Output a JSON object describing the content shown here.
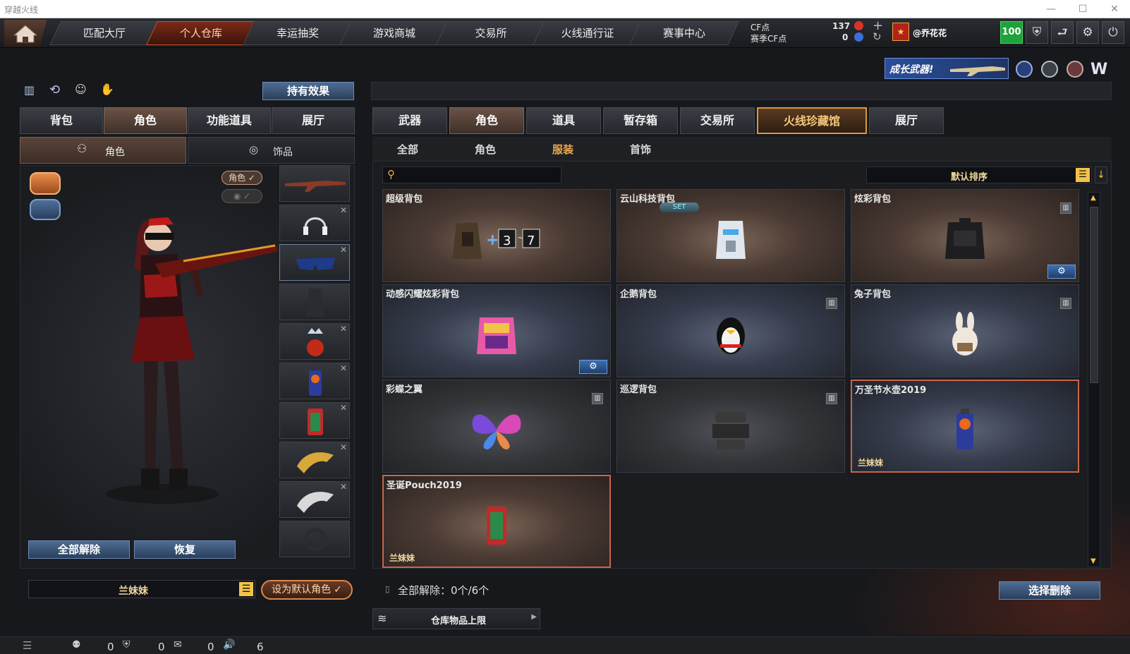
{
  "window": {
    "title": "穿越火线",
    "min": "—",
    "max": "☐",
    "close": "✕"
  },
  "nav": {
    "tabs": [
      "匹配大厅",
      "个人仓库",
      "幸运抽奖",
      "游戏商城",
      "交易所",
      "火线通行证",
      "赛事中心"
    ],
    "active_index": 1,
    "cf_label": "CF点",
    "season_cf_label": "赛季CF点",
    "cf_value": "137",
    "season_cf_value": "0",
    "username": "@乔花花",
    "level_badge": "100"
  },
  "banner": {
    "text": "成长武器!"
  },
  "left": {
    "effect_button": "持有效果",
    "tabs": [
      "背包",
      "角色",
      "功能道具",
      "展厅"
    ],
    "active_tab": 1,
    "subtabs": [
      "角色",
      "饰品"
    ],
    "role_badge": "角色 ✓",
    "release_all": "全部解除",
    "restore": "恢复",
    "character_name": "兰妹妹",
    "set_default": "设为默认角色"
  },
  "right": {
    "tabs": [
      "武器",
      "角色",
      "道具",
      "暂存箱",
      "交易所",
      "火线珍藏馆",
      "展厅"
    ],
    "active_tab": 1,
    "highlighted_tab": 5,
    "subtabs": [
      "全部",
      "角色",
      "服装",
      "首饰"
    ],
    "active_subtab": 2,
    "search_placeholder": "",
    "sort_label": "默认排序",
    "items": [
      {
        "name": "超级背包",
        "bg": "brown",
        "icon": "backpack-bag-upgrade-icon"
      },
      {
        "name": "云山科技背包",
        "bg": "brown",
        "icon": "tech-backpack-icon",
        "set": "SET"
      },
      {
        "name": "炫彩背包",
        "bg": "brown",
        "icon": "dark-backpack-icon",
        "deletable": true,
        "gear": true
      },
      {
        "name": "动感闪耀炫彩背包",
        "bg": "blue",
        "icon": "colorful-backpack-icon",
        "gear": true
      },
      {
        "name": "企鹅背包",
        "bg": "blue",
        "icon": "penguin-backpack-icon",
        "deletable": true
      },
      {
        "name": "兔子背包",
        "bg": "blue",
        "icon": "rabbit-backpack-icon",
        "deletable": true
      },
      {
        "name": "彩蝶之翼",
        "bg": "dark",
        "icon": "butterfly-wings-icon",
        "deletable": true
      },
      {
        "name": "巡逻背包",
        "bg": "dark",
        "icon": "patrol-backpack-icon",
        "deletable": true
      },
      {
        "name": "万圣节水壶2019",
        "bg": "blue",
        "icon": "halloween-flask-icon",
        "owner": "兰妹妹",
        "selected": true
      },
      {
        "name": "圣诞Pouch2019",
        "bg": "brown",
        "icon": "christmas-pouch-icon",
        "owner": "兰妹妹",
        "selected": true
      }
    ],
    "release_info": "全部解除：0个/6个",
    "select_delete": "选择删除",
    "storage_limit": "仓库物品上限"
  },
  "statusbar": {
    "v1": "0",
    "v2": "0",
    "v3": "0",
    "v4": "6"
  }
}
